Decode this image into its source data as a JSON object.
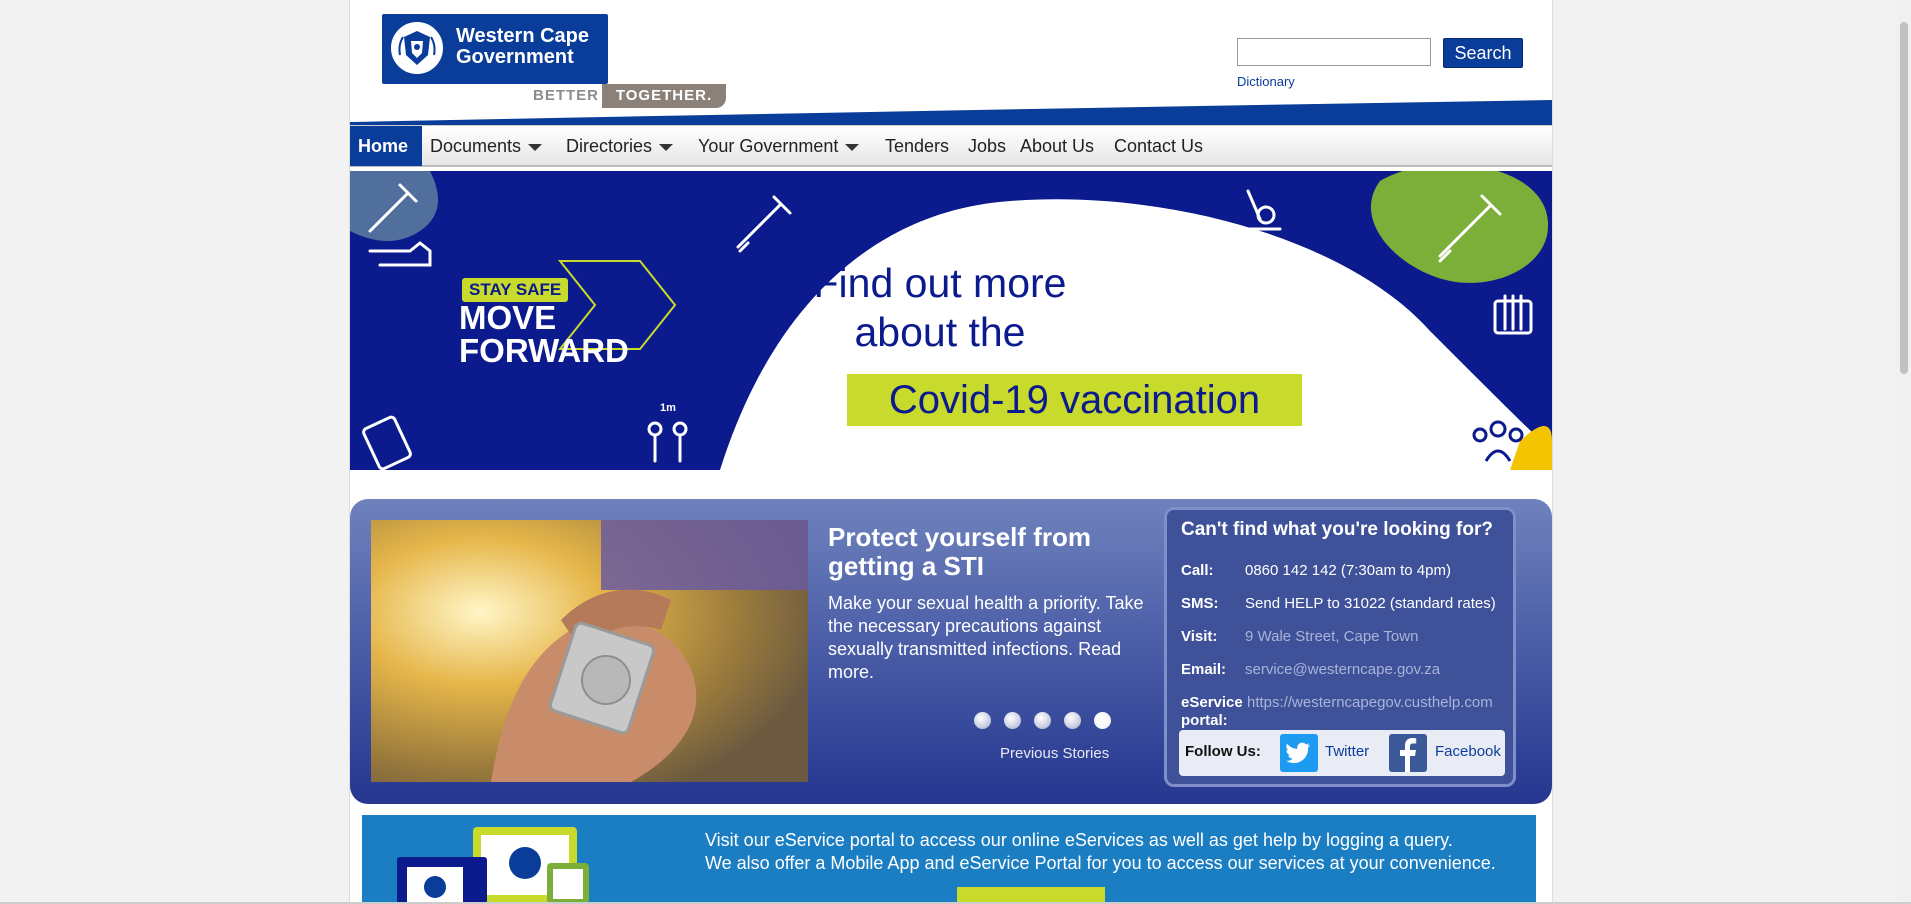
{
  "logo": {
    "name": "Western Cape Government",
    "tagline_part1": "BETTER",
    "tagline_part2": "TOGETHER."
  },
  "search": {
    "input_value": "",
    "button_label": "Search",
    "dictionary_link": "Dictionary"
  },
  "nav": {
    "items": [
      {
        "label": "Home",
        "active": true,
        "dropdown": false
      },
      {
        "label": "Documents",
        "active": false,
        "dropdown": true
      },
      {
        "label": "Directories",
        "active": false,
        "dropdown": true
      },
      {
        "label": "Your Government",
        "active": false,
        "dropdown": true
      },
      {
        "label": "Tenders",
        "active": false,
        "dropdown": false
      },
      {
        "label": "Jobs",
        "active": false,
        "dropdown": false
      },
      {
        "label": "About Us",
        "active": false,
        "dropdown": false
      },
      {
        "label": "Contact Us",
        "active": false,
        "dropdown": false
      }
    ]
  },
  "banner": {
    "badge": "STAY SAFE",
    "slogan_line1": "MOVE",
    "slogan_line2": "FORWARD",
    "distance_label": "1m",
    "headline_line1": "Find out more",
    "headline_line2": "about the",
    "highlight": "Covid-19 vaccination",
    "colors": {
      "navy": "#0b1a8c",
      "lime": "#c8da2b",
      "green": "#7cae3a",
      "yellow": "#f5c400"
    }
  },
  "story": {
    "title": "Protect yourself from getting a STI",
    "body": "Make your sexual health a priority. Take the necessary precautions against sexually transmitted infections. Read more.",
    "slide_count": 5,
    "active_slide": 5,
    "previous_label": "Previous Stories"
  },
  "contact": {
    "title": "Can't find what you're looking for?",
    "call_label": "Call:",
    "call_value": "0860 142 142 (7:30am to 4pm)",
    "sms_label": "SMS:",
    "sms_value": "Send HELP to 31022 (standard rates)",
    "visit_label": "Visit:",
    "visit_value": "9 Wale Street, Cape Town",
    "email_label": "Email:",
    "email_value": "service@westerncape.gov.za",
    "eservice_label_line1": "eService",
    "eservice_label_line2": "portal:",
    "eservice_value": "https://westerncapegov.custhelp.com",
    "follow_label": "Follow Us:",
    "twitter_label": "Twitter",
    "facebook_label": "Facebook"
  },
  "eservice_strip": {
    "line1": "Visit our eService portal to access our online eServices as well as get help by logging a query.",
    "line2": "We also offer a Mobile App and eService Portal for you to access our services at your convenience."
  },
  "colors": {
    "brand_blue": "#0a3d9a",
    "panel_gradient_top": "#6f82bd",
    "panel_gradient_bottom": "#24368f",
    "eservice_blue": "#1b7ec2",
    "twitter": "#1d9bf0",
    "facebook": "#3b5998"
  }
}
